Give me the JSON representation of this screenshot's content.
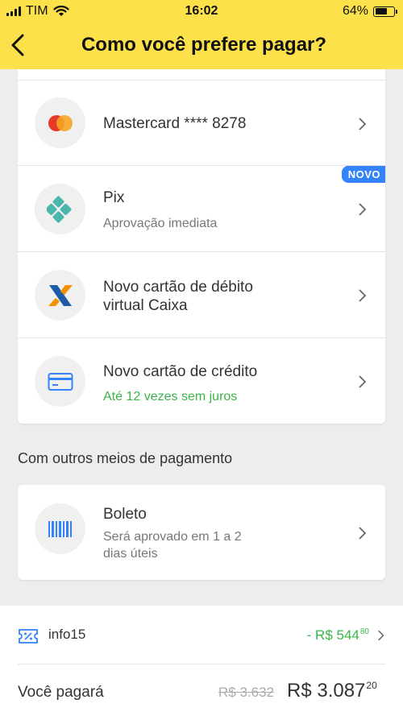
{
  "status_bar": {
    "carrier": "TIM",
    "time": "16:02",
    "battery": "64%"
  },
  "header": {
    "title": "Como você prefere pagar?"
  },
  "payment_methods": [
    {
      "title": "Mastercard **** 8278",
      "subtitle": ""
    },
    {
      "title": "Pix",
      "subtitle": "Aprovação imediata",
      "badge": "NOVO"
    },
    {
      "title_line1": "Novo cartão de débito",
      "title_line2": "virtual Caixa"
    },
    {
      "title": "Novo cartão de crédito",
      "subtitle": "Até 12 vezes sem juros"
    }
  ],
  "other_section": {
    "title": "Com outros meios de pagamento",
    "boleto": {
      "title": "Boleto",
      "subtitle_line1": "Será aprovado em 1 a 2",
      "subtitle_line2": "dias úteis"
    }
  },
  "summary": {
    "coupon_code": "info15",
    "discount_main": "- R$ 544",
    "discount_cents": "80",
    "pay_label": "Você pagará",
    "old_price": "R$ 3.632",
    "new_price_main": "R$ 3.087",
    "new_price_cents": "20"
  },
  "colors": {
    "header": "#fde14b",
    "accent_blue": "#3483fa",
    "green": "#39b54a"
  }
}
